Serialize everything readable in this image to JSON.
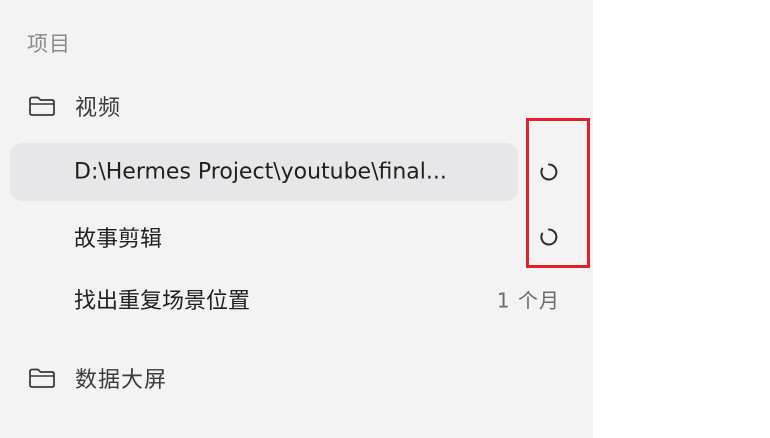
{
  "sidebar": {
    "section_header": "项目",
    "folders": [
      {
        "label": "视频",
        "icon": "folder-icon"
      },
      {
        "label": "数据大屏",
        "icon": "folder-icon"
      }
    ],
    "items": [
      {
        "label": "D:\\Hermes Project\\youtube\\final...",
        "status": "loading",
        "selected": true
      },
      {
        "label": "故事剪辑",
        "status": "loading",
        "selected": false
      },
      {
        "label": "找出重复场景位置",
        "meta": "1 个月",
        "selected": false
      }
    ]
  },
  "annotation": {
    "highlight_color": "#e0202a"
  },
  "colors": {
    "sidebar_bg": "#f3f3f3",
    "selected_bg": "#e7e7e9",
    "header_text": "#8a8a8a"
  }
}
